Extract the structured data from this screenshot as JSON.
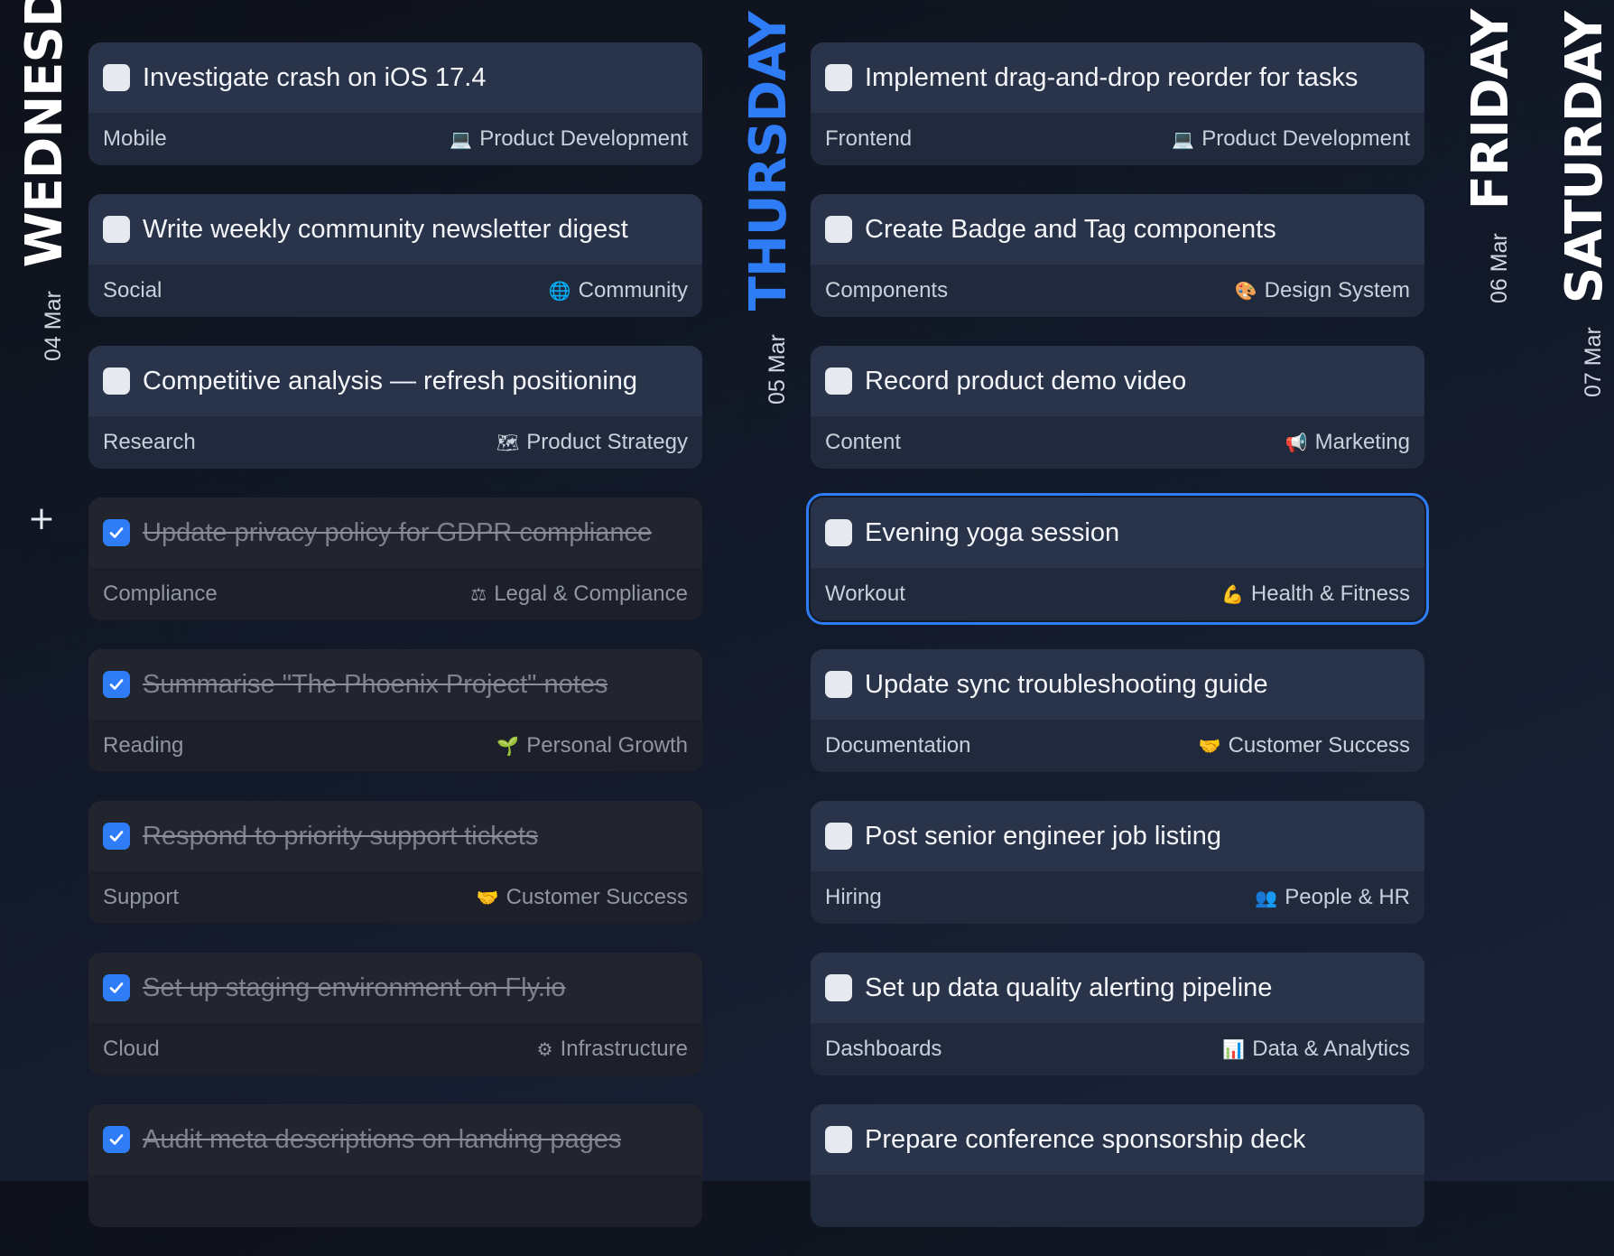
{
  "days": [
    {
      "name": "WEDNESDAY",
      "date": "04 Mar"
    },
    {
      "name": "THURSDAY",
      "date": "05 Mar"
    },
    {
      "name": "FRIDAY",
      "date": "06 Mar"
    },
    {
      "name": "SATURDAY",
      "date": "07 Mar"
    }
  ],
  "add_label": "+",
  "wednesday": [
    {
      "title": "Investigate crash on iOS 17.4",
      "tag": "Mobile",
      "category": "Product Development",
      "icon": "laptop-icon",
      "glyph": "💻",
      "done": false
    },
    {
      "title": "Write weekly community newsletter digest",
      "tag": "Social",
      "category": "Community",
      "icon": "globe-icon",
      "glyph": "🌐",
      "done": false
    },
    {
      "title": "Competitive analysis — refresh positioning",
      "tag": "Research",
      "category": "Product Strategy",
      "icon": "map-icon",
      "glyph": "🗺",
      "done": false
    },
    {
      "title": "Update privacy policy for GDPR compliance",
      "tag": "Compliance",
      "category": "Legal & Compliance",
      "icon": "scales-icon",
      "glyph": "⚖",
      "done": true
    },
    {
      "title": "Summarise \"The Phoenix Project\" notes",
      "tag": "Reading",
      "category": "Personal Growth",
      "icon": "seedling-icon",
      "glyph": "🌱",
      "done": true
    },
    {
      "title": "Respond to priority support tickets",
      "tag": "Support",
      "category": "Customer Success",
      "icon": "handshake-icon",
      "glyph": "🤝",
      "done": true
    },
    {
      "title": "Set up staging environment on Fly.io",
      "tag": "Cloud",
      "category": "Infrastructure",
      "icon": "gear-icon",
      "glyph": "⚙",
      "done": true
    },
    {
      "title": "Audit meta descriptions on landing pages",
      "tag": "",
      "category": "",
      "icon": "",
      "glyph": "",
      "done": true
    }
  ],
  "thursday": [
    {
      "title": "Implement drag-and-drop reorder for tasks",
      "tag": "Frontend",
      "category": "Product Development",
      "icon": "laptop-icon",
      "glyph": "💻",
      "done": false
    },
    {
      "title": "Create Badge and Tag components",
      "tag": "Components",
      "category": "Design System",
      "icon": "palette-icon",
      "glyph": "🎨",
      "done": false
    },
    {
      "title": "Record product demo video",
      "tag": "Content",
      "category": "Marketing",
      "icon": "megaphone-icon",
      "glyph": "📢",
      "done": false
    },
    {
      "title": "Evening yoga session",
      "tag": "Workout",
      "category": "Health & Fitness",
      "icon": "flexed-arm-icon",
      "glyph": "💪",
      "done": false,
      "selected": true
    },
    {
      "title": "Update sync troubleshooting guide",
      "tag": "Documentation",
      "category": "Customer Success",
      "icon": "handshake-icon",
      "glyph": "🤝",
      "done": false
    },
    {
      "title": "Post senior engineer job listing",
      "tag": "Hiring",
      "category": "People & HR",
      "icon": "people-icon",
      "glyph": "👥",
      "done": false
    },
    {
      "title": "Set up data quality alerting pipeline",
      "tag": "Dashboards",
      "category": "Data & Analytics",
      "icon": "bar-chart-icon",
      "glyph": "📊",
      "done": false
    },
    {
      "title": "Prepare conference sponsorship deck",
      "tag": "",
      "category": "",
      "icon": "",
      "glyph": "",
      "done": false
    }
  ],
  "colors": {
    "accent": "#2f7df6",
    "card": "#29344a",
    "card_done": "#22252e"
  }
}
